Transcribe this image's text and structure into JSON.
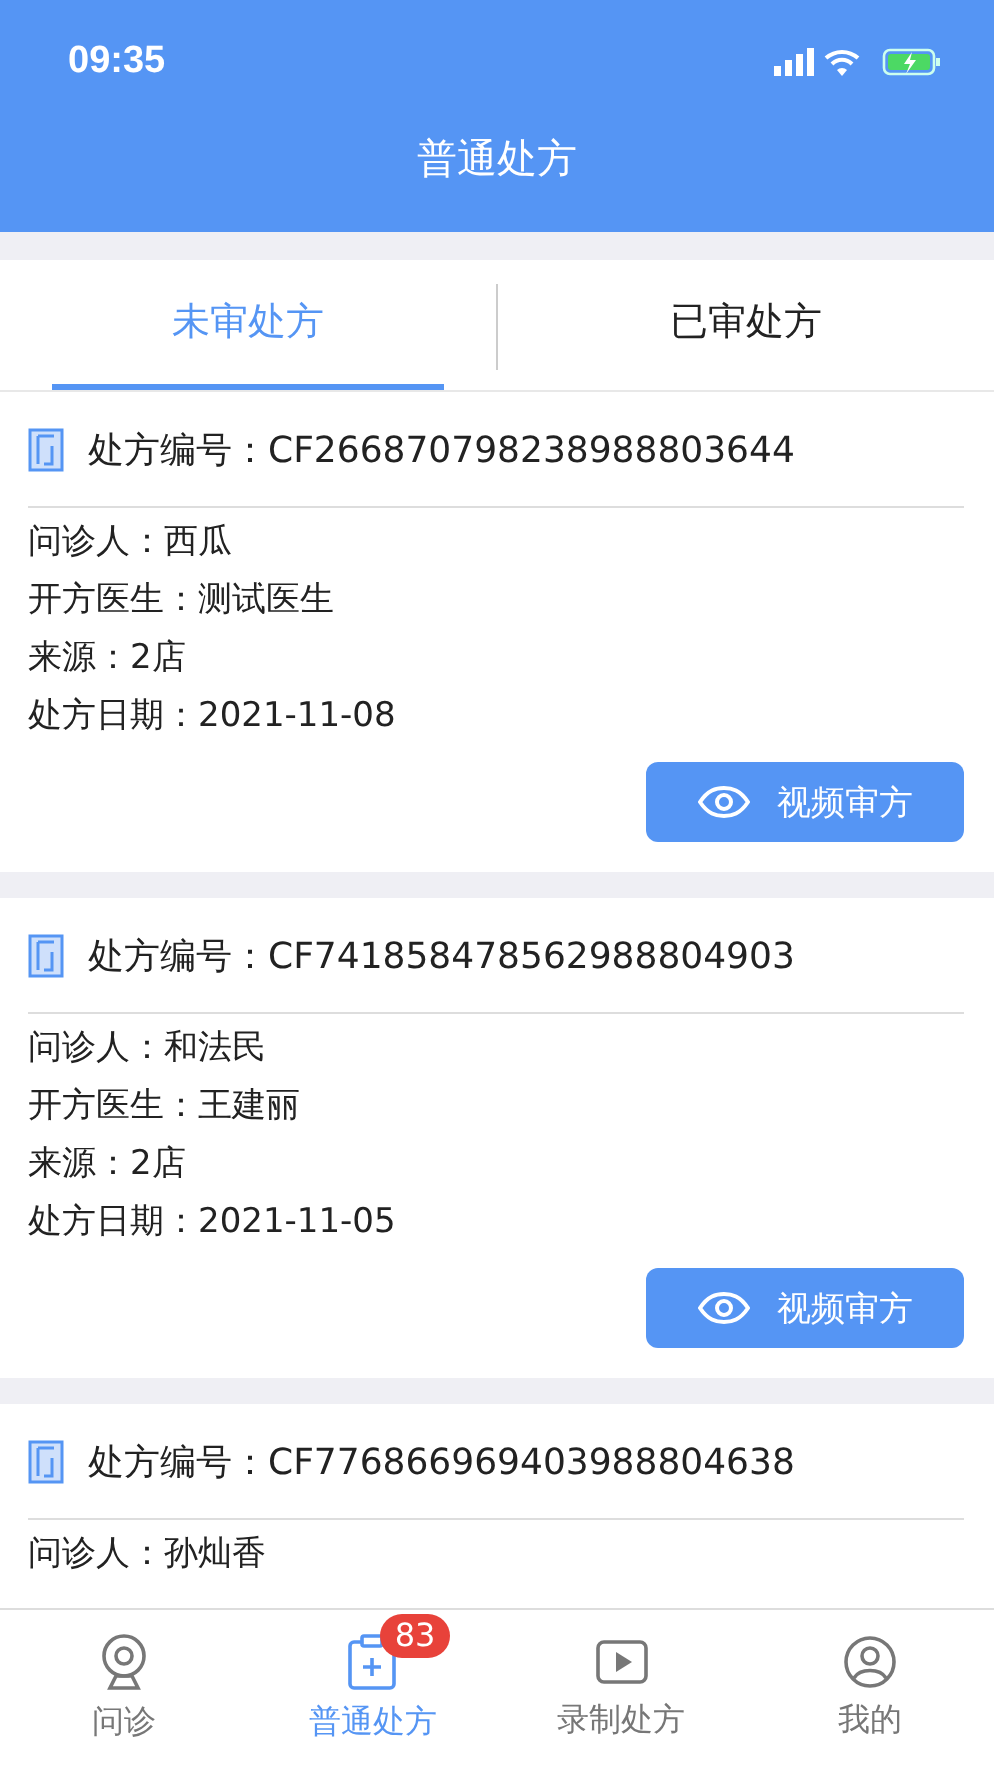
{
  "status_bar": {
    "time": "09:35"
  },
  "header": {
    "title": "普通处方"
  },
  "tabs": [
    {
      "label": "未审处方",
      "selected": true
    },
    {
      "label": "已审处方",
      "selected": false
    }
  ],
  "cards": [
    {
      "number_label": "处方编号：",
      "number": "CF266870798238988803644",
      "fields": [
        {
          "label": "问诊人：",
          "value": "西瓜"
        },
        {
          "label": "开方医生：",
          "value": "测试医生"
        },
        {
          "label": "来源：",
          "value": "2店"
        },
        {
          "label": "处方日期：",
          "value": "2021-11-08"
        }
      ],
      "button": "视频审方"
    },
    {
      "number_label": "处方编号：",
      "number": "CF741858478562988804903",
      "fields": [
        {
          "label": "问诊人：",
          "value": "和法民"
        },
        {
          "label": "开方医生：",
          "value": "王建丽"
        },
        {
          "label": "来源：",
          "value": "2店"
        },
        {
          "label": "处方日期：",
          "value": "2021-11-05"
        }
      ],
      "button": "视频审方"
    },
    {
      "number_label": "处方编号：",
      "number": "CF776866969403988804638",
      "fields": [
        {
          "label": "问诊人：",
          "value": "孙灿香"
        }
      ]
    }
  ],
  "bottom_nav": [
    {
      "kind": "camera",
      "label": "问诊",
      "selected": false
    },
    {
      "kind": "clipboard",
      "label": "普通处方",
      "selected": true,
      "badge": "83"
    },
    {
      "kind": "record",
      "label": "录制处方",
      "selected": false
    },
    {
      "kind": "person",
      "label": "我的",
      "selected": false
    }
  ]
}
